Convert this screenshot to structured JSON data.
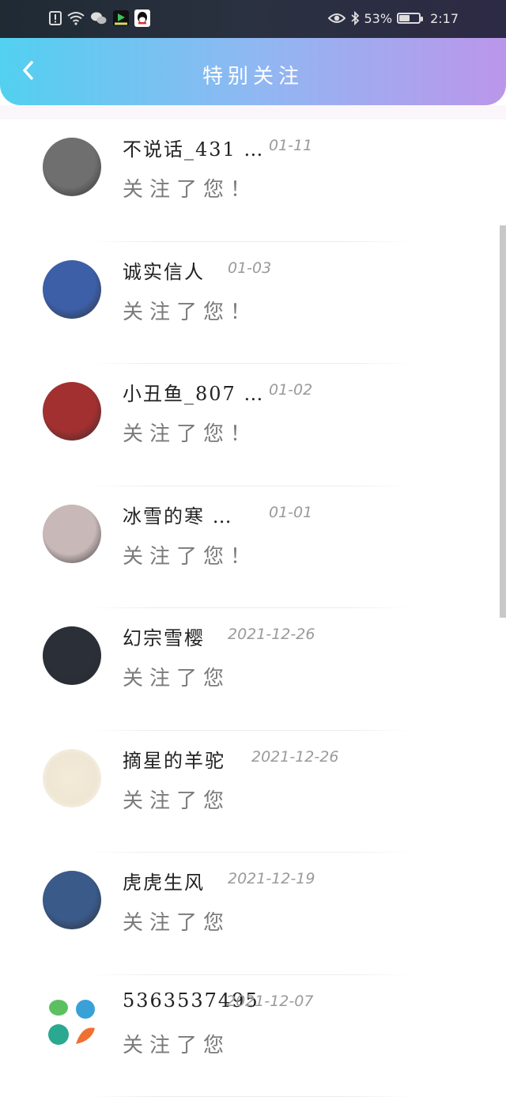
{
  "status_bar": {
    "battery_percent": "53%",
    "battery_level": 0.53,
    "time": "2:17",
    "left_icons": [
      "alert-icon",
      "wifi-icon",
      "wechat-icon",
      "video-app-icon",
      "qq-icon"
    ],
    "right_icons": [
      "eye-icon",
      "bluetooth-icon",
      "battery-icon"
    ]
  },
  "header": {
    "title": "特别关注",
    "back_icon": "chevron-left-icon"
  },
  "items": [
    {
      "name": "不说话_431 …",
      "date": "01-11",
      "message": "关注了您！",
      "avatar_color": "#6f6f6f"
    },
    {
      "name": "诚实信人",
      "date": "01-03",
      "message": "关注了您！",
      "avatar_color": "#3d5fa8"
    },
    {
      "name": "小丑鱼_807 …",
      "date": "01-02",
      "message": "关注了您！",
      "avatar_color": "#a23030"
    },
    {
      "name": "冰雪的寒 …",
      "date": "01-01",
      "message": "关注了您！",
      "avatar_color": "#c9b8b8"
    },
    {
      "name": "幻宗雪樱",
      "date": "2021-12-26",
      "message": "关注了您",
      "avatar_color": "#2a2f38"
    },
    {
      "name": "摘星的羊驼",
      "date": "2021-12-26",
      "message": "关注了您",
      "avatar_color": "#efe6d4"
    },
    {
      "name": "虎虎生风",
      "date": "2021-12-19",
      "message": "关注了您",
      "avatar_color": "#3a5a8a"
    },
    {
      "name": "5363537495",
      "date": "2021-12-07",
      "message": "关注了您",
      "avatar_color": "#ffffff"
    }
  ]
}
